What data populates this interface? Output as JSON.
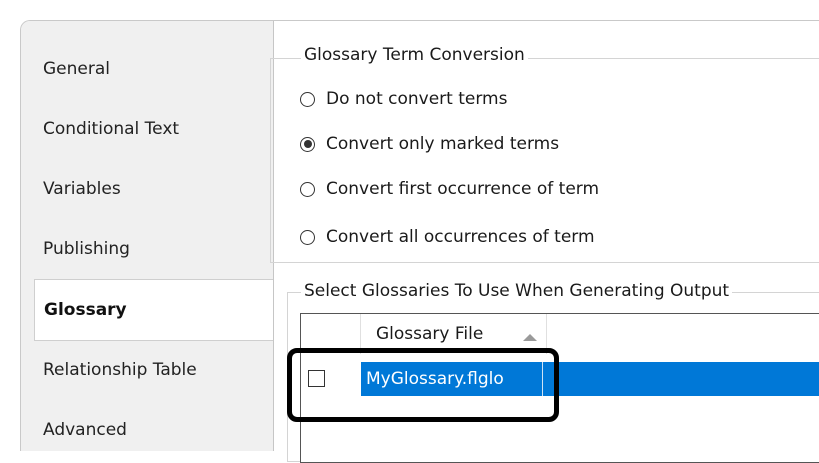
{
  "sidebar": {
    "items": [
      {
        "label": "General"
      },
      {
        "label": "Conditional Text"
      },
      {
        "label": "Variables"
      },
      {
        "label": "Publishing"
      },
      {
        "label": "Glossary",
        "selected": true
      },
      {
        "label": "Relationship Table"
      },
      {
        "label": "Advanced"
      }
    ]
  },
  "conversion": {
    "legend": "Glossary Term Conversion",
    "options": [
      {
        "label": "Do not convert terms",
        "checked": false
      },
      {
        "label": "Convert only marked terms",
        "checked": true
      },
      {
        "label": "Convert first occurrence of term",
        "checked": false
      },
      {
        "label": "Convert all occurrences of term",
        "checked": false
      }
    ]
  },
  "glossaries": {
    "legend": "Select Glossaries To Use When Generating Output",
    "column_header": "Glossary File",
    "sort": "ascending",
    "rows": [
      {
        "file": "MyGlossary.flglo",
        "checked": false,
        "selected": true
      }
    ]
  },
  "colors": {
    "selection": "#0078d7",
    "callout": "#000000"
  }
}
